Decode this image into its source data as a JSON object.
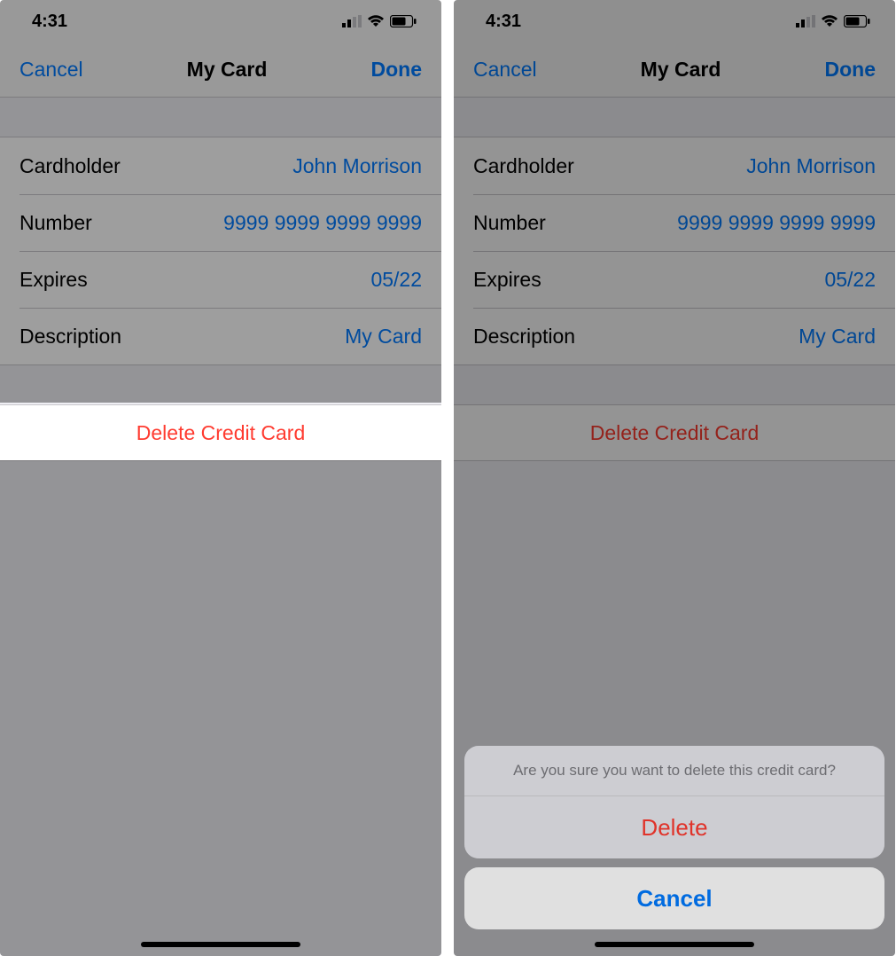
{
  "status": {
    "time": "4:31"
  },
  "nav": {
    "cancel": "Cancel",
    "title": "My Card",
    "done": "Done"
  },
  "fields": {
    "cardholder_label": "Cardholder",
    "cardholder_value": "John Morrison",
    "number_label": "Number",
    "number_value": "9999 9999 9999 9999",
    "expires_label": "Expires",
    "expires_value": "05/22",
    "description_label": "Description",
    "description_value": "My Card"
  },
  "delete_label": "Delete Credit Card",
  "sheet": {
    "message": "Are you sure you want to delete this credit card?",
    "delete": "Delete",
    "cancel": "Cancel"
  }
}
